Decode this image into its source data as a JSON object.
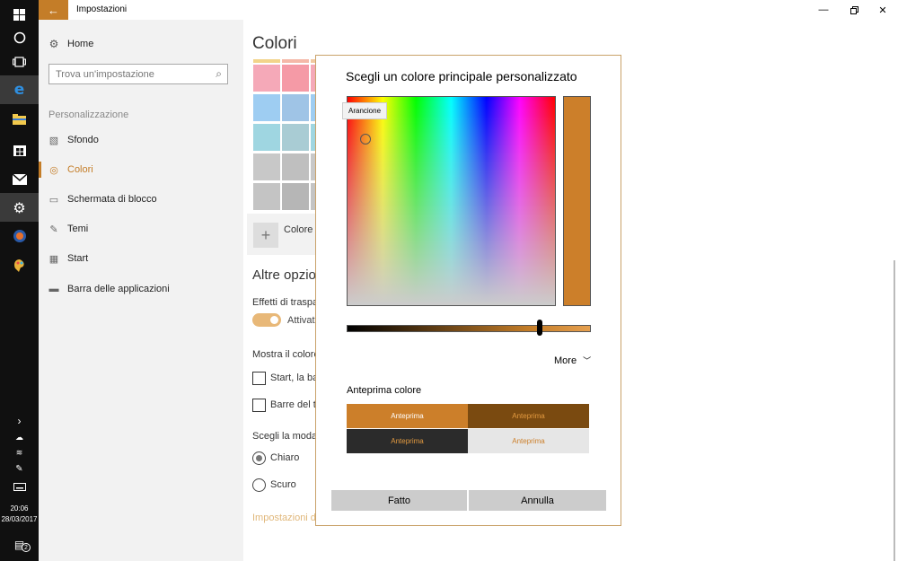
{
  "window": {
    "title": "Impostazioni"
  },
  "taskbar": {
    "clock_time": "20:06",
    "clock_date": "28/03/2017",
    "notification_count": "2",
    "icons": [
      "windows-logo-icon",
      "cortana-icon",
      "task-view-icon",
      "edge-icon",
      "file-explorer-icon",
      "store-icon",
      "mail-icon",
      "settings-icon",
      "firefox-icon",
      "paint-icon"
    ]
  },
  "sidebar": {
    "home_label": "Home",
    "search_placeholder": "Trova un'impostazione",
    "section_label": "Personalizzazione",
    "items": [
      {
        "label": "Sfondo",
        "icon": "picture-icon",
        "selected": false
      },
      {
        "label": "Colori",
        "icon": "palette-icon",
        "selected": true
      },
      {
        "label": "Schermata di blocco",
        "icon": "lock-screen-icon",
        "selected": false
      },
      {
        "label": "Temi",
        "icon": "themes-icon",
        "selected": false
      },
      {
        "label": "Start",
        "icon": "start-icon",
        "selected": false
      },
      {
        "label": "Barra delle applicazioni",
        "icon": "taskbar-icon",
        "selected": false
      }
    ]
  },
  "main": {
    "title": "Colori",
    "custom_color_label": "Colore p",
    "other_options_title": "Altre opzion",
    "transparency_label": "Effetti di traspa",
    "transparency_state": "Attivat",
    "show_color_label": "Mostra il colore",
    "checkbox_start": "Start, la ba",
    "checkbox_title_bars": "Barre del ti",
    "mode_label": "Scegli la modal",
    "radio_light": "Chiaro",
    "radio_dark": "Scuro",
    "link_label": "Impostazioni d",
    "swatch_colors": [
      [
        "#f5a9b8",
        "#f59aa6"
      ],
      [
        "#9ecdf2",
        "#9fc4e6"
      ],
      [
        "#9fd6e1",
        "#a9ccd4"
      ],
      [
        "#c8c8c8",
        "#bfbfbf"
      ],
      [
        "#c4c4c4",
        "#b6b6b6"
      ]
    ],
    "swatch_top_colors": [
      "#f2d48a",
      "#f5b8a8",
      "#f1c9a0"
    ]
  },
  "dialog": {
    "title": "Scegli un colore principale personalizzato",
    "tooltip": "Arancione",
    "selected_color": "#cc7f2a",
    "brightness": 0.79,
    "more_label": "More",
    "preview_title": "Anteprima colore",
    "previews": [
      {
        "label": "Anteprima",
        "bg": "#cc7f2a",
        "fg": "#ffffff"
      },
      {
        "label": "Anteprima",
        "bg": "#7a4a10",
        "fg": "#e39a40"
      },
      {
        "label": "Anteprima",
        "bg": "#2b2b2b",
        "fg": "#e39a40"
      },
      {
        "label": "Anteprima",
        "bg": "#e6e6e6",
        "fg": "#cc7f2a"
      }
    ],
    "done_label": "Fatto",
    "cancel_label": "Annulla"
  }
}
